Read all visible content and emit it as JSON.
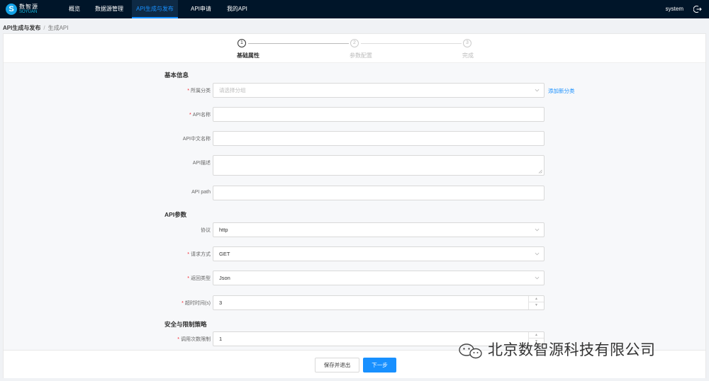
{
  "header": {
    "logo_cn": "数智源",
    "logo_en": "SOYUAN",
    "nav": [
      "概览",
      "数据源管理",
      "API生成与发布",
      "API申请",
      "我的API"
    ],
    "user": "system"
  },
  "breadcrumb": {
    "first": "API生成与发布",
    "sep": "/",
    "current": "生成API"
  },
  "steps": [
    {
      "num": "1",
      "label": "基础属性"
    },
    {
      "num": "2",
      "label": "参数配置"
    },
    {
      "num": "3",
      "label": "完成"
    }
  ],
  "sections": {
    "basic": "基本信息",
    "api_params": "API参数",
    "security": "安全与限制策略"
  },
  "fields": {
    "category": {
      "label": "所属分类",
      "placeholder": "请选择分组",
      "add_link": "添加新分类"
    },
    "api_name": {
      "label": "API名称",
      "value": ""
    },
    "api_cn_name": {
      "label": "API中文名称",
      "value": ""
    },
    "api_desc": {
      "label": "API描述",
      "value": ""
    },
    "api_path": {
      "label": "API path",
      "value": ""
    },
    "protocol": {
      "label": "协议",
      "value": "http"
    },
    "method": {
      "label": "请求方式",
      "value": "GET"
    },
    "return_type": {
      "label": "返回类型",
      "value": "Json"
    },
    "timeout": {
      "label": "超时时间(s)",
      "value": "3"
    },
    "call_limit": {
      "label": "调用次数限制",
      "value": "1"
    }
  },
  "footer": {
    "save_exit": "保存并退出",
    "next": "下一步"
  },
  "watermark": "北京数智源科技有限公司",
  "colors": {
    "nav_bg": "#001529",
    "primary": "#1890ff",
    "required": "#f5222d"
  }
}
